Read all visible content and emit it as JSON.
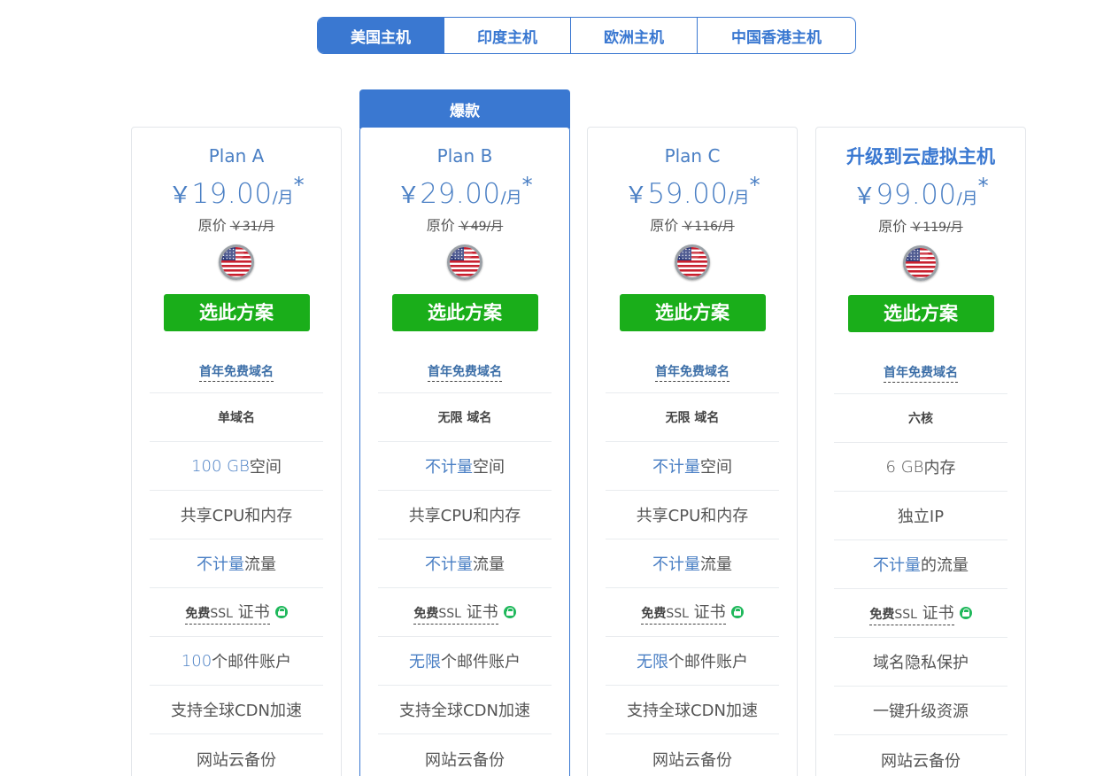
{
  "tabs": [
    {
      "label": "美国主机",
      "active": true
    },
    {
      "label": "印度主机",
      "active": false
    },
    {
      "label": "欧洲主机",
      "active": false
    },
    {
      "label": "中国香港主机",
      "active": false
    }
  ],
  "badge_label": "爆款",
  "currency_symbol": "￥",
  "per_month": "/月",
  "price_star": "*",
  "orig_label": "原价",
  "select_label": "选此方案",
  "colors": {
    "accent": "#3a78d1",
    "button_green": "#1aae1a",
    "lock_green": "#1fb85b"
  },
  "plans": [
    {
      "name": "Plan A",
      "price": "19.00",
      "orig": "￥31/月",
      "flag_icon": "us-flag-icon",
      "features": {
        "domain_free": "首年免费域名",
        "domains": "单域名",
        "space_value": "100 GB",
        "space_label": " 空间",
        "cpu": "共享CPU和内存",
        "traffic_value": "不计量",
        "traffic_label": " 流量",
        "ssl_pre": "免费",
        "ssl_mid": "SSL",
        "ssl_cert": " 证书",
        "email_value": "100",
        "email_label": " 个邮件账户",
        "cdn": "支持全球CDN加速",
        "backup": "网站云备份"
      }
    },
    {
      "name": "Plan B",
      "price": "29.00",
      "orig": "￥49/月",
      "flag_icon": "us-flag-icon",
      "features": {
        "domain_free": "首年免费域名",
        "domains": "无限 域名",
        "space_value": "不计量",
        "space_label": " 空间",
        "cpu": "共享CPU和内存",
        "traffic_value": "不计量",
        "traffic_label": " 流量",
        "ssl_pre": "免费",
        "ssl_mid": "SSL",
        "ssl_cert": " 证书",
        "email_value": "无限",
        "email_label": " 个邮件账户",
        "cdn": "支持全球CDN加速",
        "backup": "网站云备份"
      }
    },
    {
      "name": "Plan C",
      "price": "59.00",
      "orig": "￥116/月",
      "flag_icon": "us-flag-icon",
      "features": {
        "domain_free": "首年免费域名",
        "domains": "无限 域名",
        "space_value": "不计量",
        "space_label": " 空间",
        "cpu": "共享CPU和内存",
        "traffic_value": "不计量",
        "traffic_label": " 流量",
        "ssl_pre": "免费",
        "ssl_mid": "SSL",
        "ssl_cert": " 证书",
        "email_value": "无限",
        "email_label": " 个邮件账户",
        "cdn": "支持全球CDN加速",
        "backup": "网站云备份"
      }
    },
    {
      "name": "升级到云虚拟主机",
      "price": "99.00",
      "orig": "￥119/月",
      "flag_icon": "us-flag-icon",
      "features": {
        "domain_free": "首年免费域名",
        "cores": "六核",
        "memory_value": "6 GB",
        "memory_label": " 内存",
        "ip": "独立IP",
        "traffic_value": "不计量",
        "traffic_label": " 的流量",
        "ssl_pre": "免费",
        "ssl_mid": "SSL",
        "ssl_cert": " 证书",
        "privacy": "域名隐私保护",
        "upgrade": "一键升级资源",
        "backup": "网站云备份"
      }
    }
  ]
}
